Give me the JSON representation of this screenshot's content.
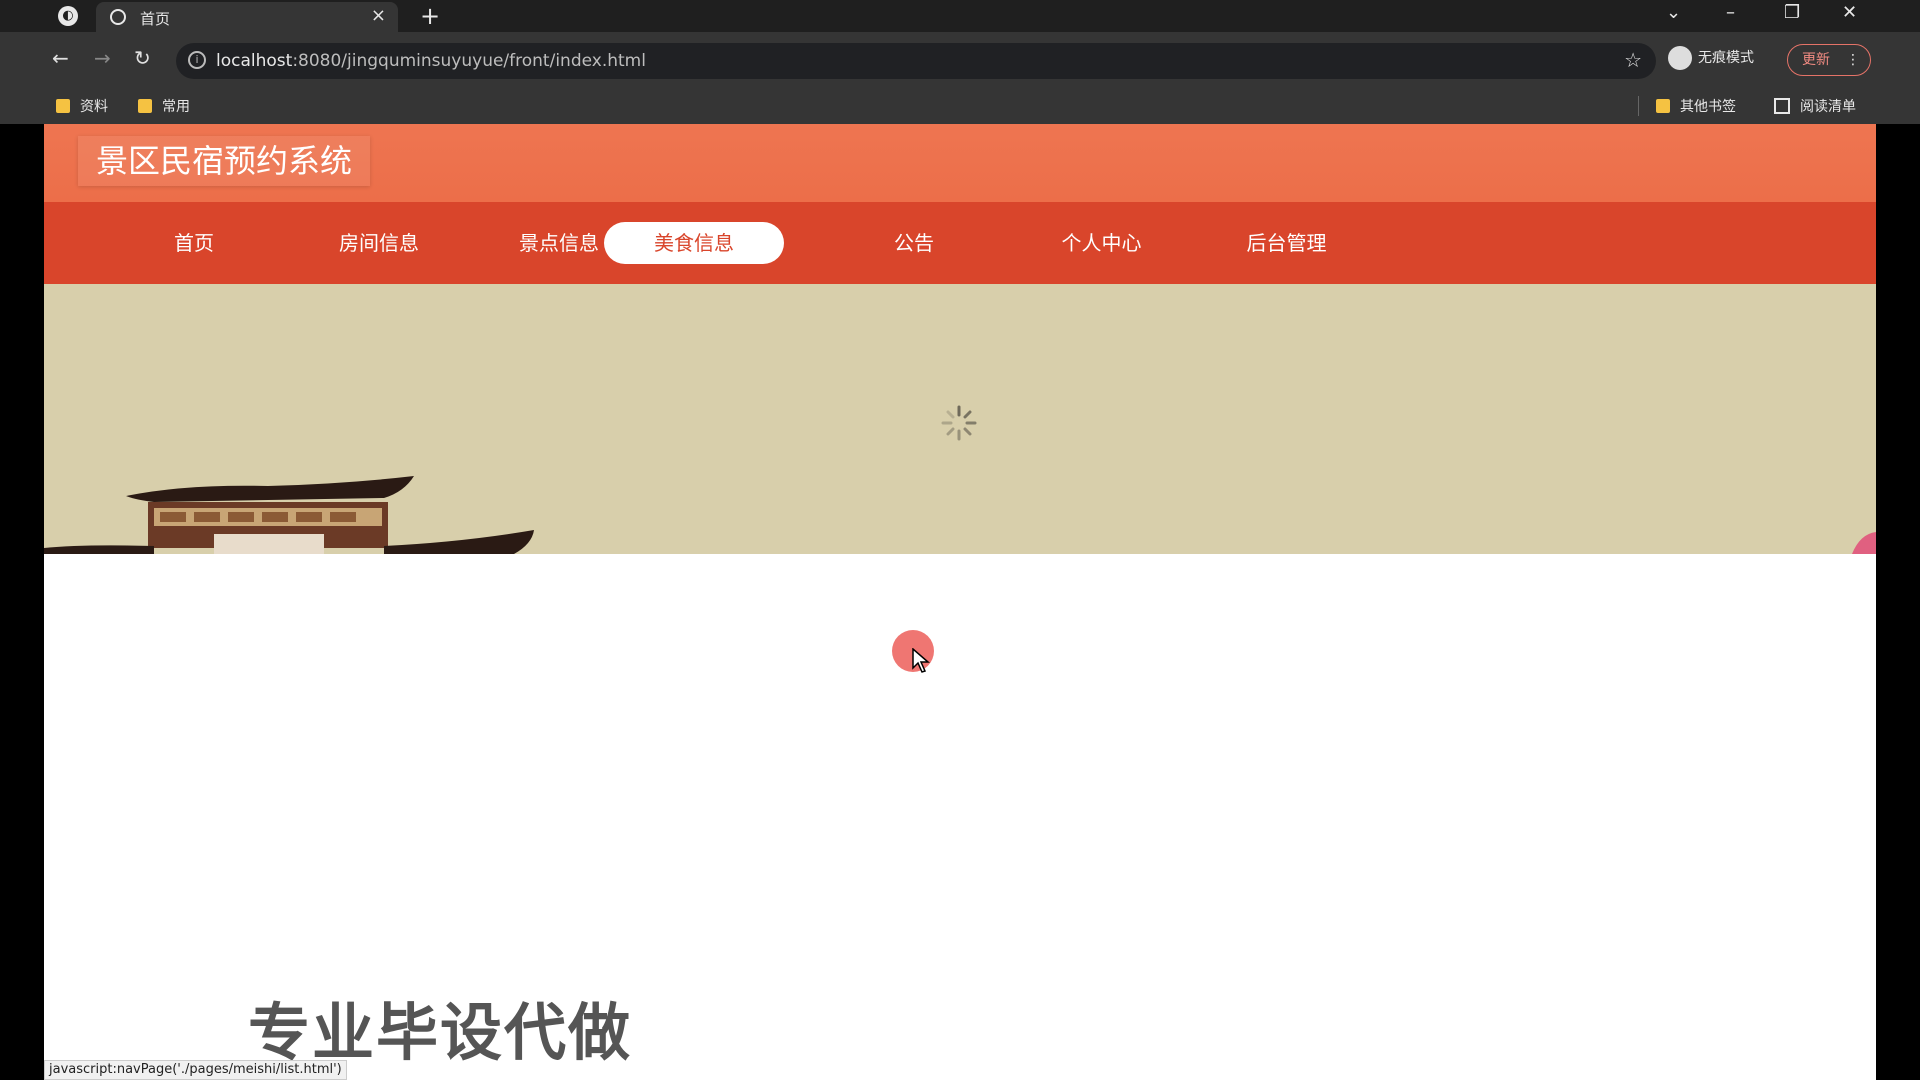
{
  "browser": {
    "tab_title": "首页",
    "tab_close": "×",
    "new_tab": "+",
    "url_host": "localhost",
    "url_rest": ":8080/jingquminsuyuyue/front/index.html",
    "incognito_label": "无痕模式",
    "update_label": "更新",
    "bookmarks": [
      "资料",
      "常用"
    ],
    "other_bookmarks": "其他书签",
    "reading_list": "阅读清单"
  },
  "site": {
    "title": "景区民宿预约系统",
    "nav": [
      {
        "label": "首页"
      },
      {
        "label": "房间信息"
      },
      {
        "label": "景点信息"
      },
      {
        "label": "美食信息",
        "active": true
      },
      {
        "label": "公告"
      },
      {
        "label": "个人中心"
      },
      {
        "label": "后台管理"
      }
    ]
  },
  "overlay": {
    "watermark": "专业毕设代做"
  },
  "status_bar": "javascript:navPage('./pages/meishi/list.html')",
  "colors": {
    "header": "#ee7551",
    "nav": "#d9452b",
    "banner": "#d8cfab"
  }
}
